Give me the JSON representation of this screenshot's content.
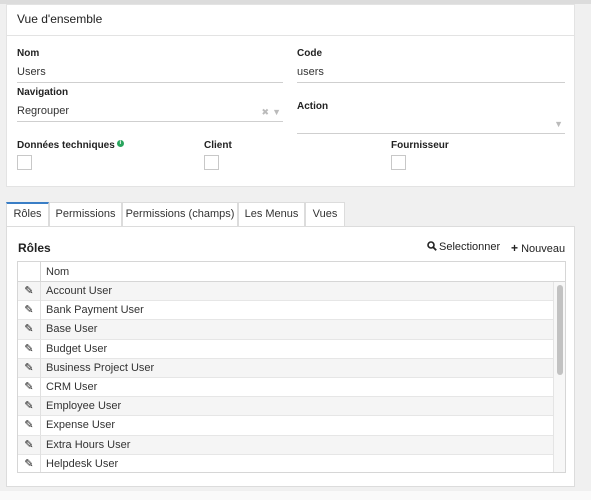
{
  "overview": {
    "title": "Vue d'ensemble",
    "nom": {
      "label": "Nom",
      "value": "Users"
    },
    "code": {
      "label": "Code",
      "value": "users"
    },
    "navigation": {
      "label": "Navigation",
      "value": "Regrouper",
      "clear_icon": "clear-icon",
      "dropdown_icon": "chevron-down-icon"
    },
    "action": {
      "label": "Action",
      "value": "",
      "dropdown_icon": "chevron-down-icon"
    },
    "donnees_techniques": {
      "label": "Données techniques",
      "info_icon": "info-icon"
    },
    "client": {
      "label": "Client"
    },
    "fournisseur": {
      "label": "Fournisseur"
    }
  },
  "tabs": [
    {
      "label": "Rôles",
      "active": true
    },
    {
      "label": "Permissions"
    },
    {
      "label": "Permissions (champs)"
    },
    {
      "label": "Les Menus"
    },
    {
      "label": "Vues"
    }
  ],
  "roles_panel": {
    "title": "Rôles",
    "select_label": "Selectionner",
    "add_label": "Nouveau",
    "column_header": "Nom",
    "rows": [
      "Account User",
      "Bank Payment User",
      "Base User",
      "Budget User",
      "Business Project User",
      "CRM User",
      "Employee User",
      "Expense User",
      "Extra Hours User",
      "Helpdesk User"
    ]
  },
  "colors": {
    "accent": "#3a7ec6",
    "info": "#2aa55e"
  }
}
